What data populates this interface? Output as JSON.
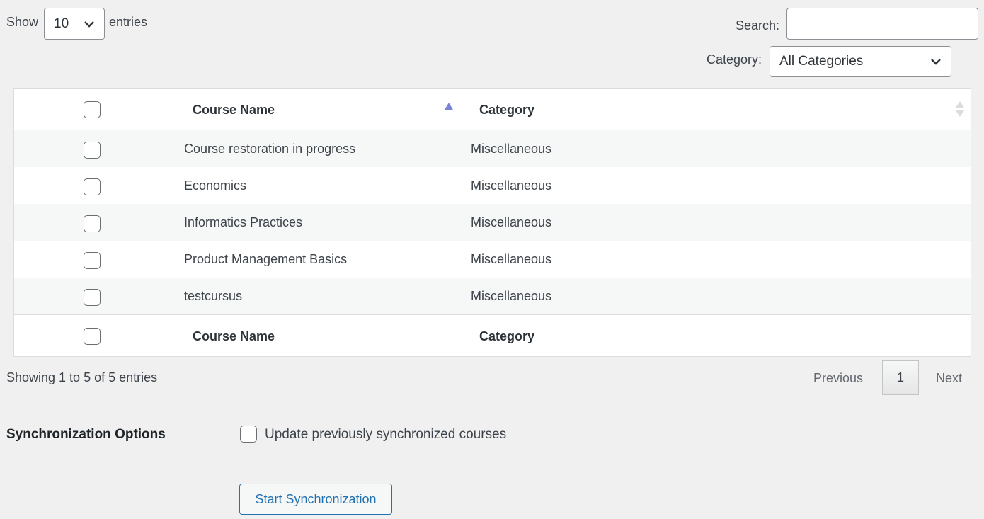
{
  "length_control": {
    "show_label": "Show",
    "value": "10",
    "entries_label": "entries"
  },
  "search": {
    "label": "Search:",
    "value": ""
  },
  "category_filter": {
    "label": "Category:",
    "value": "All Categories"
  },
  "table": {
    "headers": {
      "course_name": "Course Name",
      "category": "Category"
    },
    "rows": [
      {
        "course_name": "Course restoration in progress",
        "category": "Miscellaneous"
      },
      {
        "course_name": "Economics",
        "category": "Miscellaneous"
      },
      {
        "course_name": "Informatics Practices",
        "category": "Miscellaneous"
      },
      {
        "course_name": "Product Management Basics",
        "category": "Miscellaneous"
      },
      {
        "course_name": "testcursus",
        "category": "Miscellaneous"
      }
    ]
  },
  "info": "Showing 1 to 5 of 5 entries",
  "pagination": {
    "previous": "Previous",
    "current": "1",
    "next": "Next"
  },
  "sync": {
    "label": "Synchronization Options",
    "option_label": "Update previously synchronized courses",
    "button_label": "Start Synchronization"
  },
  "colors": {
    "accent": "#2271b1",
    "sort_arrow": "#7b83d6",
    "row_stripe": "#f6f7f7"
  }
}
